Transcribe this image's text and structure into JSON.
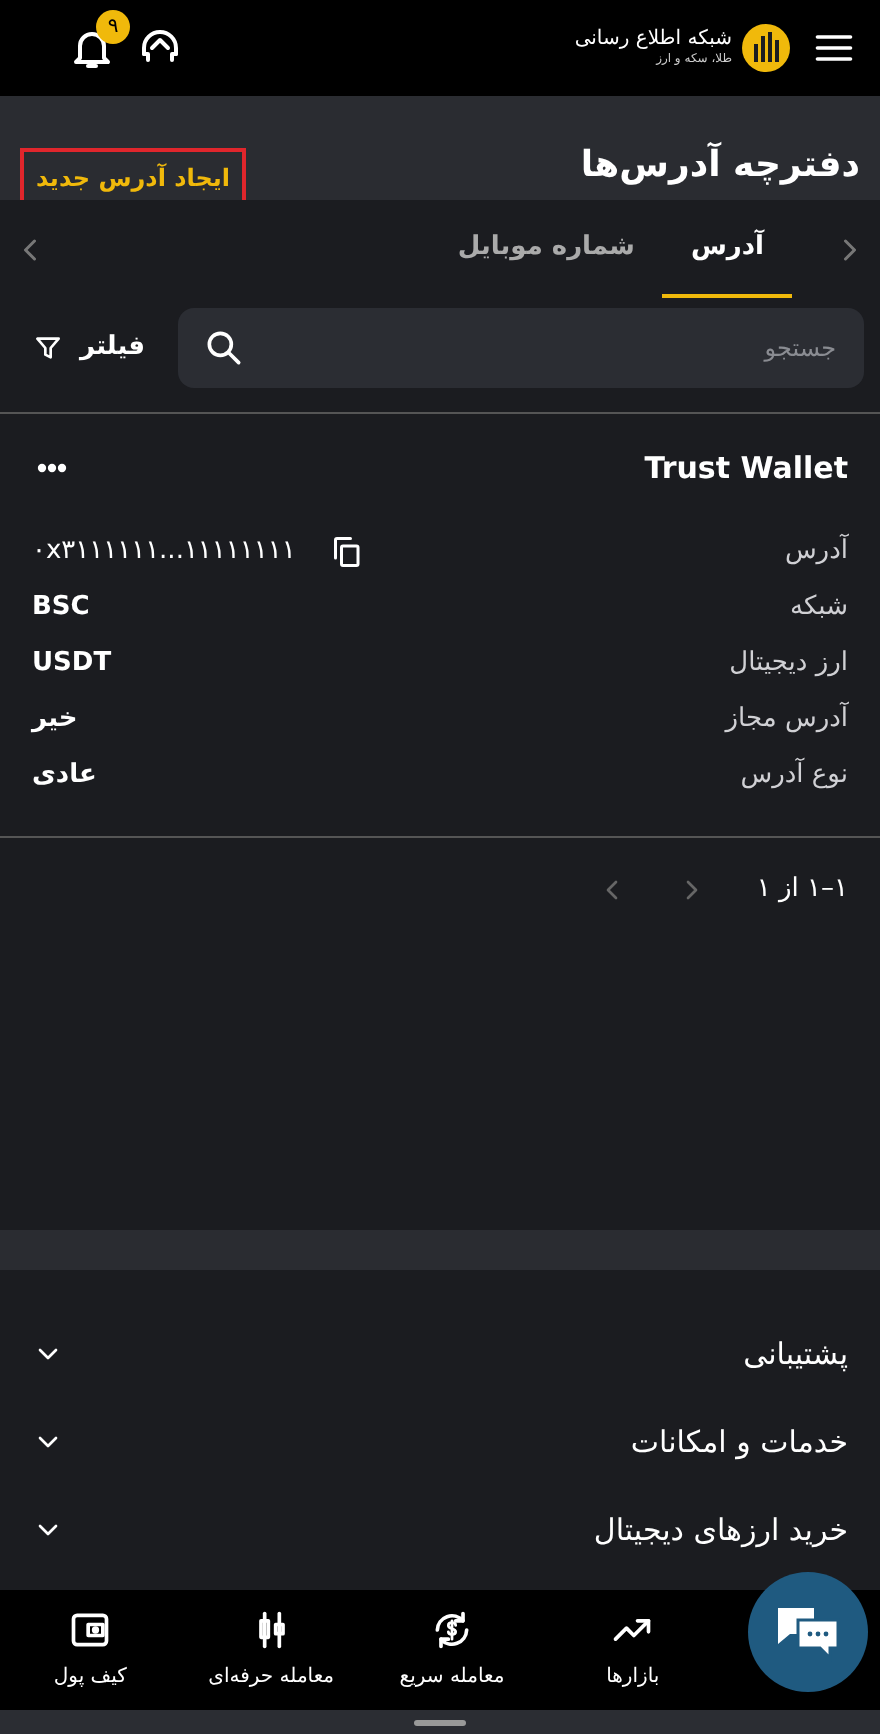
{
  "header": {
    "logo_lines": [
      "شبکه اطلاع رسانی",
      "طلا، سکه و ارز"
    ],
    "notification_count": "۹"
  },
  "page": {
    "title": "دفترچه آدرس‌ها",
    "new_button": "ایجاد آدرس جدید"
  },
  "tabs": [
    {
      "label": "آدرس",
      "selected": true
    },
    {
      "label": "شماره موبایل",
      "selected": false
    }
  ],
  "search": {
    "placeholder": "جستجو"
  },
  "filter": {
    "label": "فیلتر"
  },
  "address_card": {
    "name": "Trust Wallet",
    "fields": [
      {
        "label": "آدرس",
        "value": "۰x۳۱۱۱۱۱۱...۱۱۱۱۱۱۱۱",
        "copyable": true
      },
      {
        "label": "شبکه",
        "value": "BSC",
        "copyable": false
      },
      {
        "label": "ارز دیجیتال",
        "value": "USDT",
        "copyable": false
      },
      {
        "label": "آدرس مجاز",
        "value": "خیر",
        "copyable": false
      },
      {
        "label": "نوع آدرس",
        "value": "عادی",
        "copyable": false
      }
    ]
  },
  "pagination": {
    "range": "۱–۱ از ۱"
  },
  "footer_sections": [
    {
      "label": "پشتیبانی",
      "expanded": false
    },
    {
      "label": "خدمات و امکانات",
      "expanded": false
    },
    {
      "label": "خرید ارزهای دیجیتال",
      "expanded": false
    }
  ],
  "bottom_nav": [
    {
      "kind": "markets",
      "label": "بازارها"
    },
    {
      "kind": "quick",
      "label": "معامله سریع"
    },
    {
      "kind": "pro",
      "label": "معامله حرفه‌ای"
    },
    {
      "kind": "wallet",
      "label": "کیف پول"
    }
  ]
}
